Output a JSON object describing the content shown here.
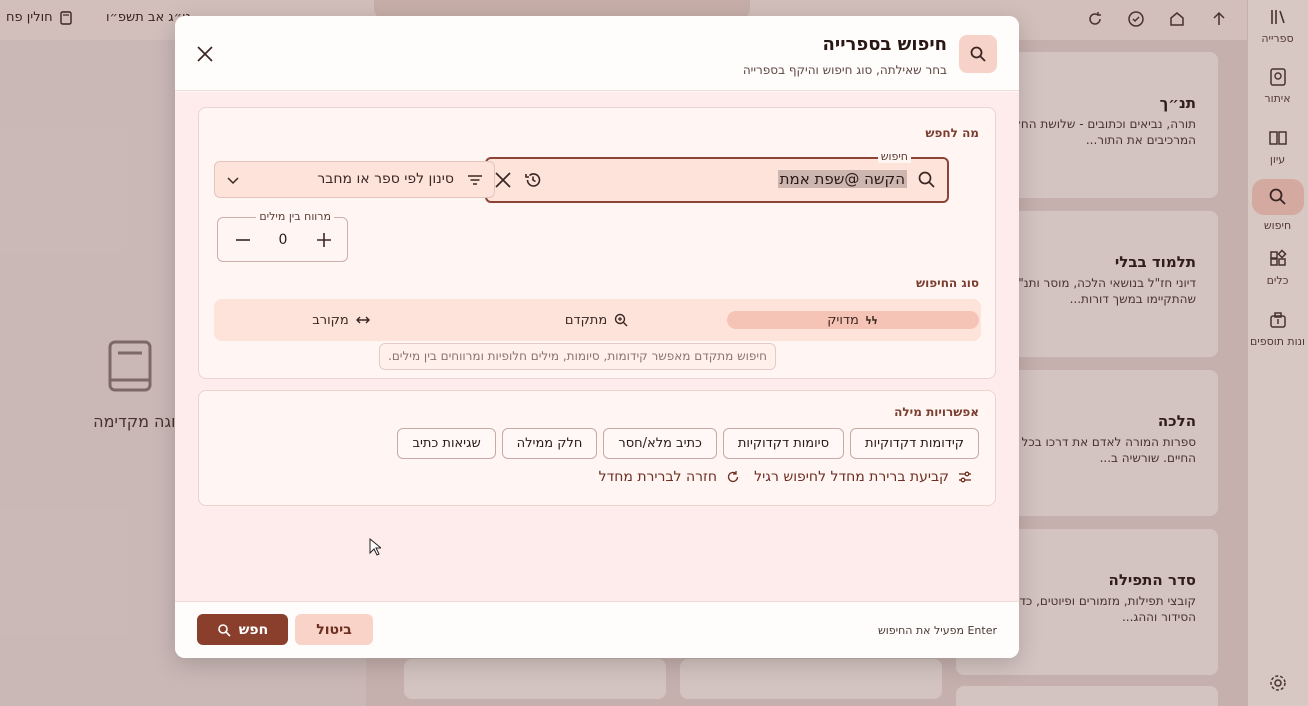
{
  "background": {
    "tabs": [
      {
        "label": "חולין פח"
      },
      {
        "label": "ט״ג אב תשפ״ו"
      }
    ],
    "rail": [
      {
        "label": "ספרייה",
        "icon": "library-icon"
      },
      {
        "label": "איתור",
        "icon": "locate-book-icon"
      },
      {
        "label": "עיון",
        "icon": "open-book-icon"
      },
      {
        "label": "חיפוש",
        "icon": "search-icon"
      },
      {
        "label": "כלים",
        "icon": "tools-icon"
      },
      {
        "label": "ונות תוספים",
        "icon": "plugins-icon"
      }
    ],
    "preview_text": "בחר ספר לתצוגה מקדימה",
    "cards": [
      {
        "title": "תנ״ך",
        "desc": "תורה, נביאים וכתובים - שלושת החלקים המרכיבים את התור..."
      },
      {
        "title": "תלמוד בבלי",
        "desc": "דיוני חז\"ל בנושאי הלכה, מוסר ותנ\"ך שהתקיימו במשך דורות..."
      },
      {
        "title": "הלכה",
        "desc": "ספרות המורה לאדם את דרכו בכל תחומי החיים. שורשיה ב..."
      },
      {
        "title": "סדר התפילה",
        "desc": "קובצי תפילות, מזמורים ופיוטים, כדוגמת הסידור וההג..."
      }
    ]
  },
  "dialog": {
    "title": "חיפוש בספרייה",
    "subtitle": "בחר שאילתה, סוג חיפוש והיקף בספרייה",
    "what_section": {
      "title": "מה לחפש",
      "search_label": "חיפוש",
      "search_value": "הקשה @שפת אמת",
      "filter_placeholder": "סינון לפי ספר או מחבר",
      "gap_label": "מרווח בין מילים",
      "gap_value": "0",
      "type_title": "סוג החיפוש",
      "types": [
        {
          "label": "מדויק",
          "icon": "quote-icon",
          "active": true
        },
        {
          "label": "מתקדם",
          "icon": "zoom-search-icon",
          "active": false
        },
        {
          "label": "מקורב",
          "icon": "arrows-horizontal-icon",
          "active": false
        }
      ],
      "tooltip": "חיפוש מתקדם מאפשר קידומות, סיומות, מילים חלופיות ומרווחים בין מילים."
    },
    "word_options": {
      "title": "אפשרויות מילה",
      "chips": [
        "קידומות דקדוקיות",
        "סיומות דקדוקיות",
        "כתיב מלא/חסר",
        "חלק ממילה",
        "שגיאות כתיב"
      ],
      "set_default": "קביעת ברירת מחדל לחיפוש רגיל",
      "reset_default": "חזרה לברירת מחדל"
    },
    "footer": {
      "hint": "Enter מפעיל את החיפוש",
      "cancel": "ביטול",
      "search": "חפש"
    }
  },
  "colors": {
    "accent": "#8a3f2d",
    "accent_light": "#f9d3c7",
    "surface": "#fff6f4"
  }
}
